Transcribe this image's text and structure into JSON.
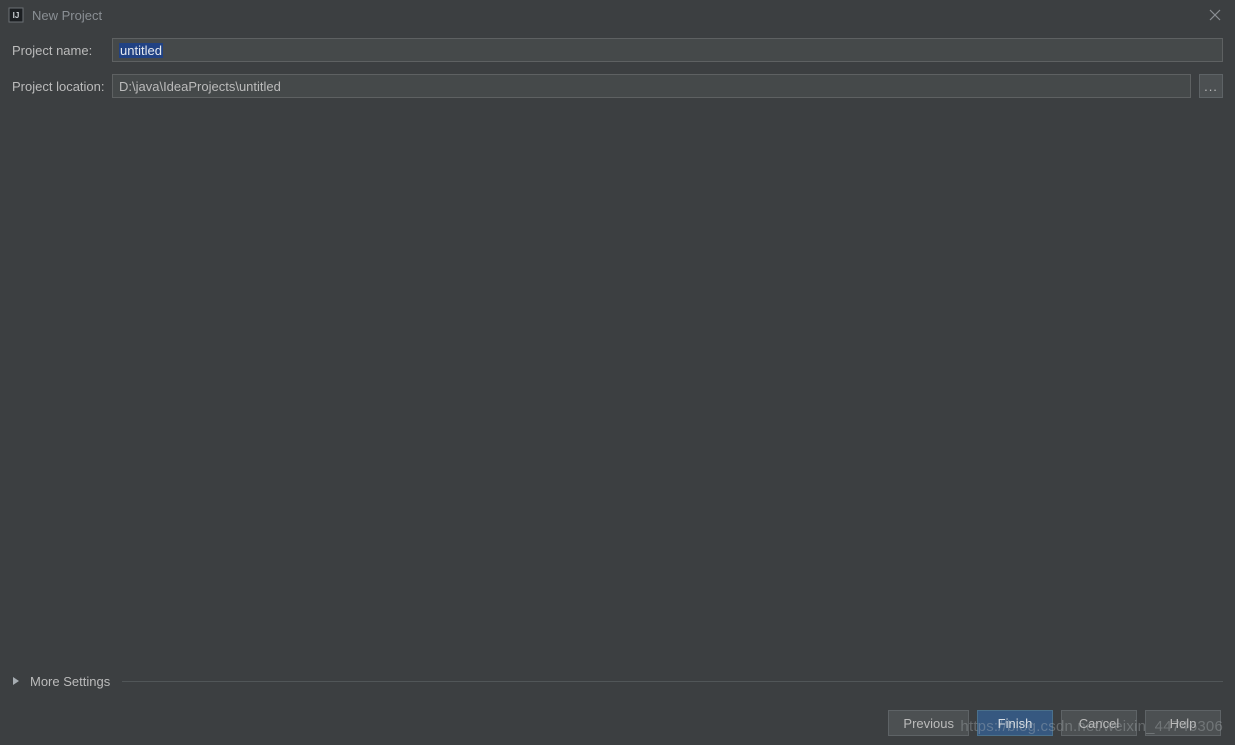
{
  "window": {
    "title": "New Project"
  },
  "form": {
    "project_name_label": "Project name:",
    "project_name_value": "untitled",
    "project_location_label": "Project location:",
    "project_location_value": "D:\\java\\IdeaProjects\\untitled",
    "browse_label": "..."
  },
  "more_settings": {
    "label": "More Settings"
  },
  "footer": {
    "previous": "Previous",
    "finish": "Finish",
    "cancel": "Cancel",
    "help": "Help"
  },
  "watermark": "https://blog.csdn.net/weixin_44746306"
}
